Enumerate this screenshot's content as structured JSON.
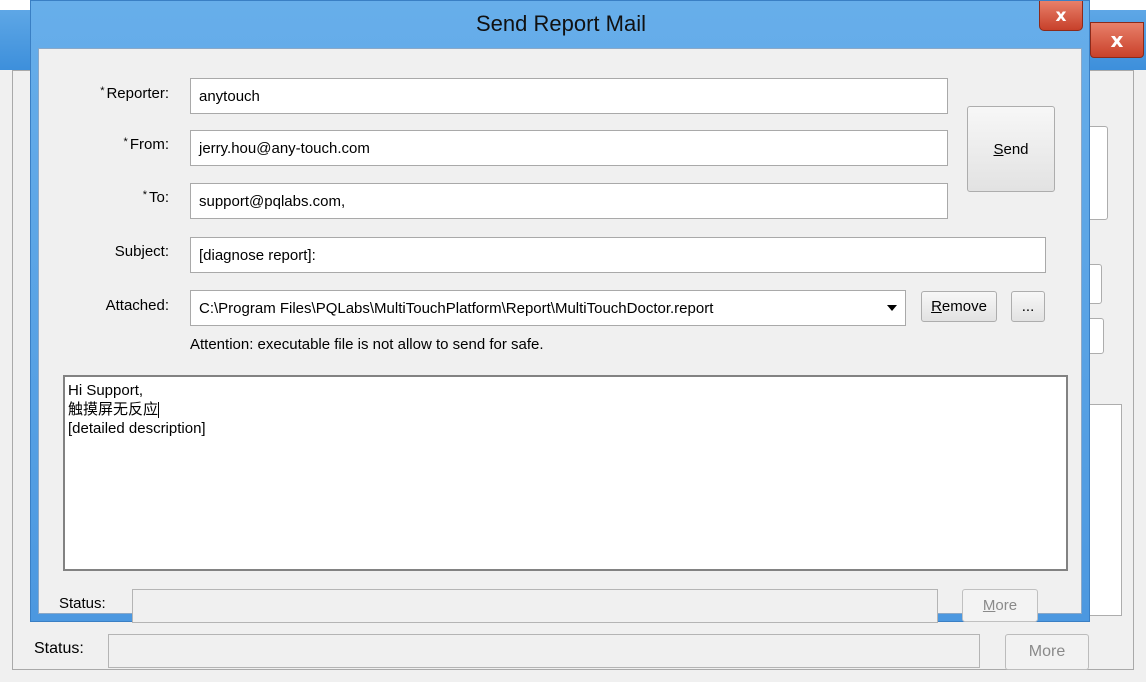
{
  "background_window": {
    "close_glyph": "x",
    "status_label": "Status:",
    "status_value": "",
    "more_label": "More"
  },
  "dialog": {
    "title": "Send Report Mail",
    "close_glyph": "x",
    "reporter": {
      "label": "Reporter:",
      "required_mark": "*",
      "value": "anytouch"
    },
    "from": {
      "label": "From:",
      "required_mark": "*",
      "value": "jerry.hou@any-touch.com"
    },
    "to": {
      "label": "To:",
      "required_mark": "*",
      "value": "support@pqlabs.com,"
    },
    "subject": {
      "label": "Subject:",
      "value": "[diagnose report]:"
    },
    "attached": {
      "label": "Attached:",
      "value": "C:\\Program Files\\PQLabs\\MultiTouchPlatform\\Report\\MultiTouchDoctor.report"
    },
    "send_button": {
      "label_underlined": "S",
      "label_rest": "end"
    },
    "remove_button": {
      "label_underlined": "R",
      "label_rest": "emove"
    },
    "browse_button": {
      "label": "..."
    },
    "attention_note": "Attention: executable file is not allow to send for safe.",
    "message_body": {
      "lines": [
        "Hi Support,",
        "触摸屏无反应",
        "[detailed description]"
      ]
    },
    "status_label": "Status:",
    "status_value": "",
    "more_button": {
      "label_underlined": "M",
      "label_rest": "ore"
    }
  },
  "icons": {
    "combo_arrow": "chevron-down-icon",
    "close": "close-icon"
  },
  "colors": {
    "titlebar": "#4c98e0",
    "close_button": "#c7402a",
    "client_background": "#f0f0f0"
  }
}
